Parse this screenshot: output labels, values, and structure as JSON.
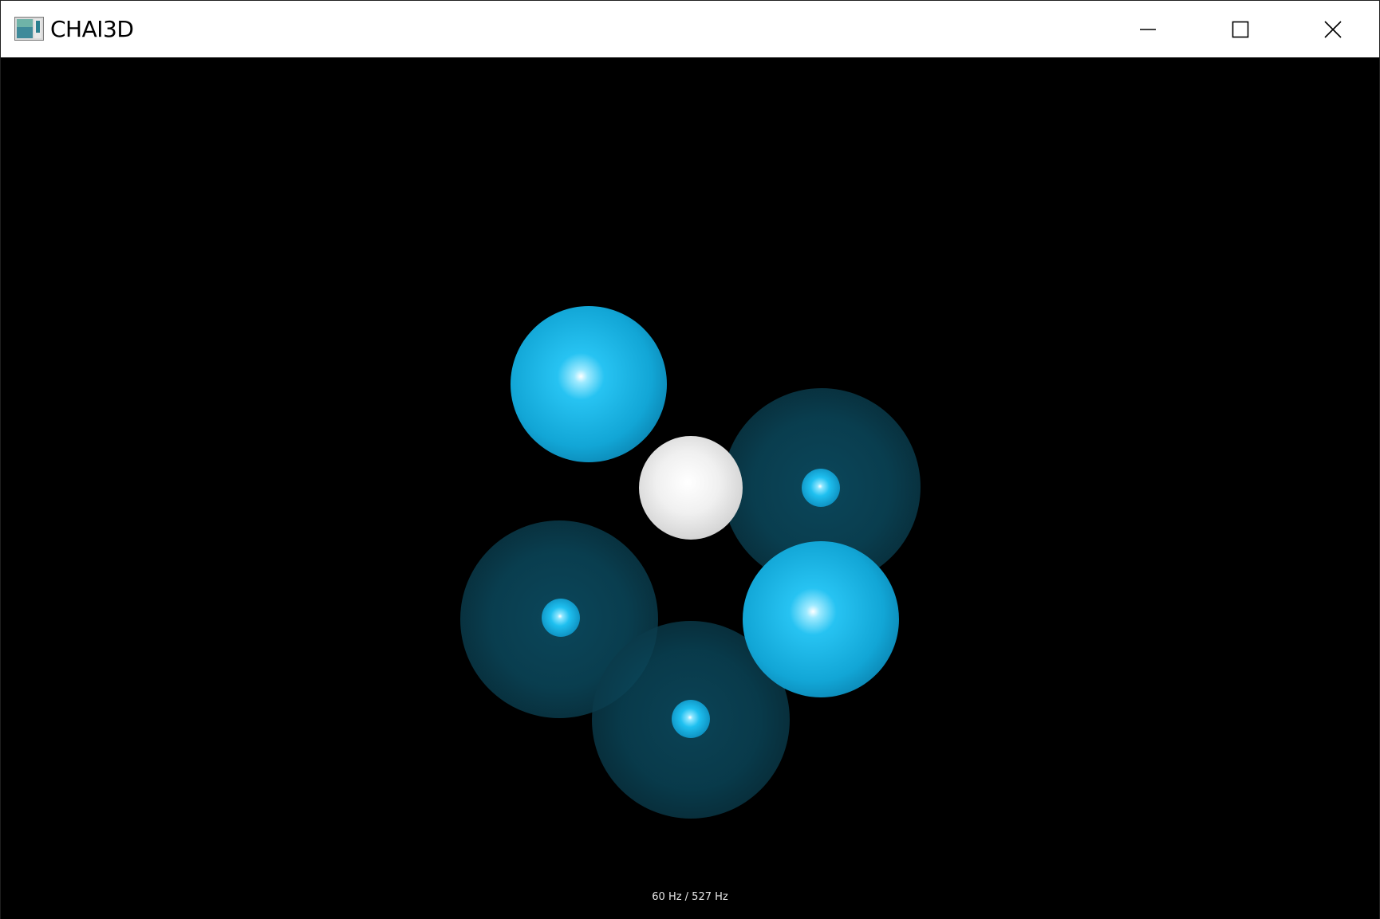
{
  "window": {
    "title": "CHAI3D",
    "controls": {
      "minimize": "minimize-icon",
      "maximize": "maximize-icon",
      "close": "close-icon"
    }
  },
  "scene": {
    "background": "#000000",
    "colors": {
      "cyan": "#1fb6e6",
      "cyan_dark": "#0b4f66",
      "white_sphere": "#eeeeee"
    }
  },
  "status": {
    "rate_text": "60 Hz / 527 Hz"
  }
}
